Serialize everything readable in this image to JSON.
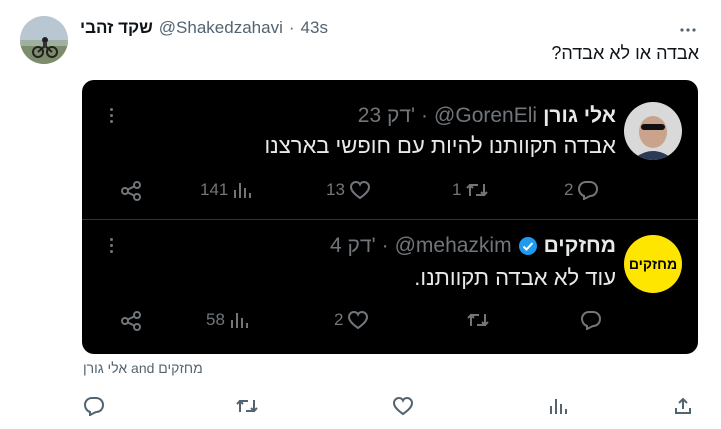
{
  "tweet": {
    "author_name": "שקד זהבי",
    "author_handle": "@Shakedzahavi",
    "time": "43s",
    "text": "אבדה או לא אבדה?",
    "liked_by": "אלי גורן and מחזקים"
  },
  "quotes": [
    {
      "name": "אלי גורן",
      "handle": "@GorenEli",
      "time": "23 דק'",
      "verified": false,
      "text": "אבדה תקוותנו להיות עם חופשי בארצנו",
      "replies": "2",
      "retweets": "1",
      "likes": "13",
      "views": "141"
    },
    {
      "name": "מחזקים",
      "handle": "@mehazkim",
      "time": "4 דק'",
      "verified": true,
      "avatar_text": "מחזקים",
      "text": "עוד לא אבדה תקוותנו.",
      "replies": "",
      "retweets": "",
      "likes": "2",
      "views": "58"
    }
  ],
  "colors": {
    "embed_bg": "#000000",
    "muted": "#71767b",
    "verified": "#1d9bf0",
    "mehazkim_yellow": "#ffe600"
  },
  "icons": [
    "more-icon",
    "share-icon",
    "views-icon",
    "like-icon",
    "retweet-icon",
    "reply-icon",
    "verified-badge-icon",
    "bookmark-icon"
  ]
}
